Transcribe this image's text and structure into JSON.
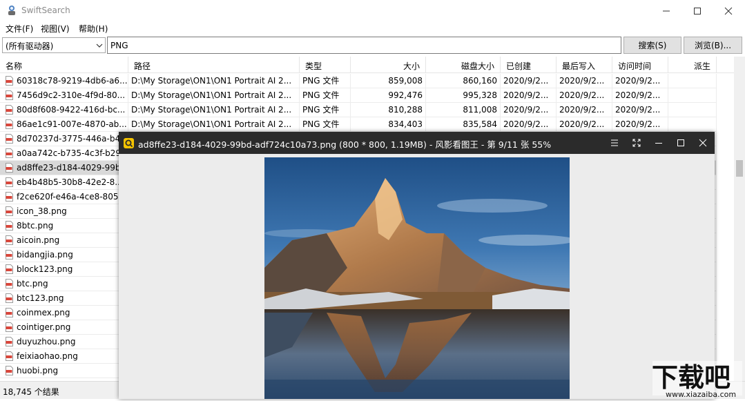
{
  "app": {
    "title": "SwiftSearch"
  },
  "menu": [
    "文件(F)",
    "视图(V)",
    "帮助(H)"
  ],
  "toolbar": {
    "drive_select": "(所有驱动器)",
    "search_value": "PNG",
    "search_button": "搜索(S)",
    "browse_button": "浏览(B)..."
  },
  "table": {
    "columns": [
      "名称",
      "路径",
      "类型",
      "大小",
      "磁盘大小",
      "已创建",
      "最后写入",
      "访问时间",
      "派生"
    ],
    "rows": [
      {
        "name": "60318c78-9219-4db6-a6...",
        "path": "D:\\My Storage\\ON1\\ON1 Portrait AI 2...",
        "type": "PNG 文件",
        "size": "859,008",
        "disk": "860,160",
        "created": "2020/9/2...",
        "written": "2020/9/2...",
        "accessed": "2020/9/2..."
      },
      {
        "name": "7456d9c2-310e-4f9d-80...",
        "path": "D:\\My Storage\\ON1\\ON1 Portrait AI 2...",
        "type": "PNG 文件",
        "size": "992,476",
        "disk": "995,328",
        "created": "2020/9/2...",
        "written": "2020/9/2...",
        "accessed": "2020/9/2..."
      },
      {
        "name": "80d8f608-9422-416d-bc...",
        "path": "D:\\My Storage\\ON1\\ON1 Portrait AI 2...",
        "type": "PNG 文件",
        "size": "810,288",
        "disk": "811,008",
        "created": "2020/9/2...",
        "written": "2020/9/2...",
        "accessed": "2020/9/2..."
      },
      {
        "name": "86ae1c91-007e-4870-ab...",
        "path": "D:\\My Storage\\ON1\\ON1 Portrait AI 2...",
        "type": "PNG 文件",
        "size": "834,403",
        "disk": "835,584",
        "created": "2020/9/2...",
        "written": "2020/9/2...",
        "accessed": "2020/9/2..."
      },
      {
        "name": "8d70237d-3775-446a-b4",
        "path": "",
        "type": "",
        "size": "",
        "disk": "",
        "created": "",
        "written": "",
        "accessed": ""
      },
      {
        "name": "a0aa742c-b735-4c3f-b29",
        "path": "",
        "type": "",
        "size": "",
        "disk": "",
        "created": "",
        "written": "",
        "accessed": ""
      },
      {
        "name": "ad8ffe23-d184-4029-99b",
        "path": "",
        "type": "",
        "size": "",
        "disk": "",
        "created": "",
        "written": "",
        "accessed": ""
      },
      {
        "name": "eb4b48b5-30b8-42e2-8...",
        "path": "",
        "type": "",
        "size": "",
        "disk": "",
        "created": "",
        "written": "",
        "accessed": ""
      },
      {
        "name": "f2ce620f-e46a-4ce8-805...",
        "path": "",
        "type": "",
        "size": "",
        "disk": "",
        "created": "",
        "written": "",
        "accessed": ""
      },
      {
        "name": "icon_38.png",
        "path": "",
        "type": "",
        "size": "",
        "disk": "",
        "created": "",
        "written": "",
        "accessed": ""
      },
      {
        "name": "8btc.png",
        "path": "",
        "type": "",
        "size": "",
        "disk": "",
        "created": "",
        "written": "",
        "accessed": ""
      },
      {
        "name": "aicoin.png",
        "path": "",
        "type": "",
        "size": "",
        "disk": "",
        "created": "",
        "written": "",
        "accessed": ""
      },
      {
        "name": "bidangjia.png",
        "path": "",
        "type": "",
        "size": "",
        "disk": "",
        "created": "",
        "written": "",
        "accessed": ""
      },
      {
        "name": "block123.png",
        "path": "",
        "type": "",
        "size": "",
        "disk": "",
        "created": "",
        "written": "",
        "accessed": ""
      },
      {
        "name": "btc.png",
        "path": "",
        "type": "",
        "size": "",
        "disk": "",
        "created": "",
        "written": "",
        "accessed": ""
      },
      {
        "name": "btc123.png",
        "path": "",
        "type": "",
        "size": "",
        "disk": "",
        "created": "",
        "written": "",
        "accessed": ""
      },
      {
        "name": "coinmex.png",
        "path": "",
        "type": "",
        "size": "",
        "disk": "",
        "created": "",
        "written": "",
        "accessed": ""
      },
      {
        "name": "cointiger.png",
        "path": "",
        "type": "",
        "size": "",
        "disk": "",
        "created": "",
        "written": "",
        "accessed": ""
      },
      {
        "name": "duyuzhou.png",
        "path": "",
        "type": "",
        "size": "",
        "disk": "",
        "created": "",
        "written": "",
        "accessed": ""
      },
      {
        "name": "feixiaohao.png",
        "path": "",
        "type": "",
        "size": "",
        "disk": "",
        "created": "",
        "written": "",
        "accessed": ""
      },
      {
        "name": "huobi.png",
        "path": "",
        "type": "",
        "size": "",
        "disk": "",
        "created": "",
        "written": "",
        "accessed": ""
      }
    ],
    "selected_row": 6
  },
  "status": {
    "count": "18,745 个结果"
  },
  "viewer": {
    "title": "ad8ffe23-d184-4029-99bd-adf724c10a73.png (800 * 800, 1.19MB) - 风影看图王 - 第 9/11 张 55%",
    "image_subject": "mountain-lake-reflection"
  },
  "watermark": {
    "brand": "下载吧",
    "url": "www.xiazaiba.com"
  },
  "colors": {
    "file_icon": "#d9463b",
    "viewer_titlebar": "#2b2b2b",
    "viewer_logo": "#f5c400",
    "selection": "#d9d9d9"
  }
}
